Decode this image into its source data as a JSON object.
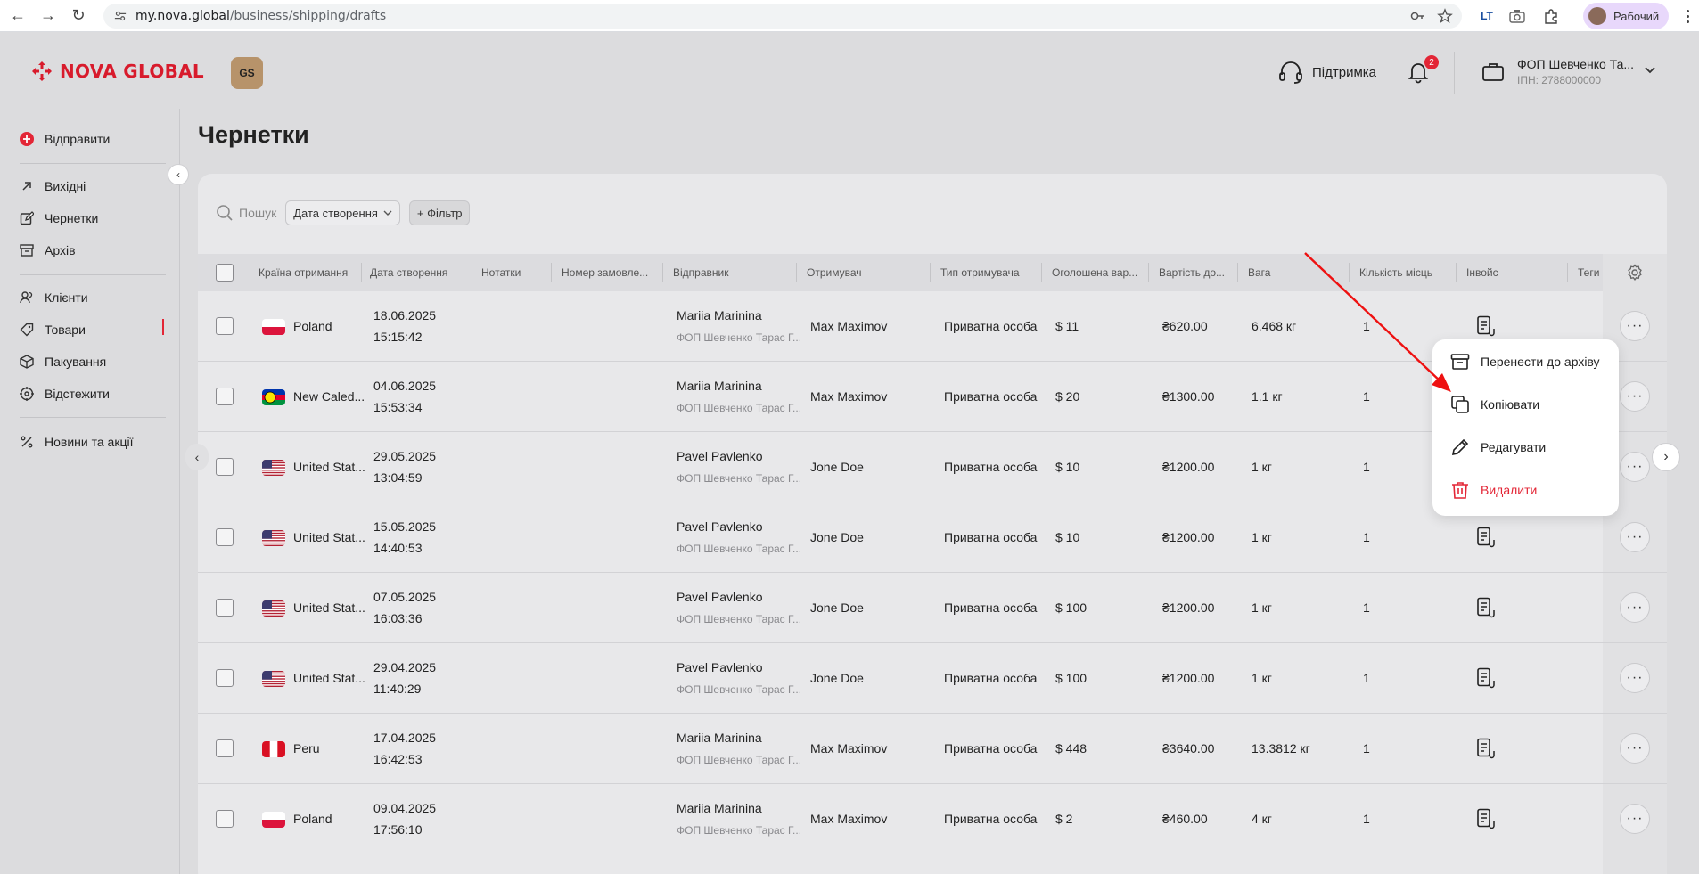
{
  "browser": {
    "url_host": "my.nova.global",
    "url_path": "/business/shipping/drafts",
    "profile_label": "Рабочий"
  },
  "header": {
    "logo_text": "NOVA GLOBAL",
    "workspace_badge": "GS",
    "support_label": "Підтримка",
    "notifications_count": "2",
    "company_name": "ФОП Шевченко Та...",
    "company_inn": "ІПН: 2788000000"
  },
  "sidebar": {
    "send_label": "Відправити",
    "items": [
      {
        "label": "Вихідні",
        "icon": "outgoing-arrow-icon"
      },
      {
        "label": "Чернетки",
        "icon": "edit-icon"
      },
      {
        "label": "Архів",
        "icon": "archive-icon"
      },
      {
        "label": "Клієнти",
        "icon": "users-icon"
      },
      {
        "label": "Товари",
        "icon": "tag-icon"
      },
      {
        "label": "Пакування",
        "icon": "box-icon"
      },
      {
        "label": "Відстежити",
        "icon": "track-icon"
      },
      {
        "label": "Новини та акції",
        "icon": "percent-icon"
      }
    ]
  },
  "page": {
    "title": "Чернетки",
    "search_placeholder": "Пошук",
    "sort_label": "Дата створення",
    "filter_label": "+ Фільтр"
  },
  "table": {
    "columns": [
      "Країна отримання",
      "Дата створення",
      "Нотатки",
      "Номер замовле...",
      "Відправник",
      "Отримувач",
      "Тип отримувача",
      "Оголошена вар...",
      "Вартість до...",
      "Вага",
      "Кількість місць",
      "Інвойс",
      "Теги"
    ],
    "rows": [
      {
        "country": "Poland",
        "flag": "pl",
        "date": "18.06.2025",
        "time": "15:15:42",
        "sender": "Mariia Marinina",
        "sender_company": "ФОП Шевченко Тарас Г...",
        "recipient": "Max Maximov",
        "recipient_type": "Приватна особа",
        "declared": "$ 11",
        "delivery": "₴620.00",
        "weight": "6.468 кг",
        "places": "1"
      },
      {
        "country": "New Caled...",
        "flag": "nc",
        "date": "04.06.2025",
        "time": "15:53:34",
        "sender": "Mariia Marinina",
        "sender_company": "ФОП Шевченко Тарас Г...",
        "recipient": "Max Maximov",
        "recipient_type": "Приватна особа",
        "declared": "$ 20",
        "delivery": "₴1300.00",
        "weight": "1.1 кг",
        "places": "1"
      },
      {
        "country": "United Stat...",
        "flag": "us",
        "date": "29.05.2025",
        "time": "13:04:59",
        "sender": "Pavel Pavlenko",
        "sender_company": "ФОП Шевченко Тарас Г...",
        "recipient": "Jone Doe",
        "recipient_type": "Приватна особа",
        "declared": "$ 10",
        "delivery": "₴1200.00",
        "weight": "1 кг",
        "places": "1"
      },
      {
        "country": "United Stat...",
        "flag": "us",
        "date": "15.05.2025",
        "time": "14:40:53",
        "sender": "Pavel Pavlenko",
        "sender_company": "ФОП Шевченко Тарас Г...",
        "recipient": "Jone Doe",
        "recipient_type": "Приватна особа",
        "declared": "$ 10",
        "delivery": "₴1200.00",
        "weight": "1 кг",
        "places": "1"
      },
      {
        "country": "United Stat...",
        "flag": "us",
        "date": "07.05.2025",
        "time": "16:03:36",
        "sender": "Pavel Pavlenko",
        "sender_company": "ФОП Шевченко Тарас Г...",
        "recipient": "Jone Doe",
        "recipient_type": "Приватна особа",
        "declared": "$ 100",
        "delivery": "₴1200.00",
        "weight": "1 кг",
        "places": "1"
      },
      {
        "country": "United Stat...",
        "flag": "us",
        "date": "29.04.2025",
        "time": "11:40:29",
        "sender": "Pavel Pavlenko",
        "sender_company": "ФОП Шевченко Тарас Г...",
        "recipient": "Jone Doe",
        "recipient_type": "Приватна особа",
        "declared": "$ 100",
        "delivery": "₴1200.00",
        "weight": "1 кг",
        "places": "1"
      },
      {
        "country": "Peru",
        "flag": "pe",
        "date": "17.04.2025",
        "time": "16:42:53",
        "sender": "Mariia Marinina",
        "sender_company": "ФОП Шевченко Тарас Г...",
        "recipient": "Max Maximov",
        "recipient_type": "Приватна особа",
        "declared": "$ 448",
        "delivery": "₴3640.00",
        "weight": "13.3812 кг",
        "places": "1"
      },
      {
        "country": "Poland",
        "flag": "pl",
        "date": "09.04.2025",
        "time": "17:56:10",
        "sender": "Mariia Marinina",
        "sender_company": "ФОП Шевченко Тарас Г...",
        "recipient": "Max Maximov",
        "recipient_type": "Приватна особа",
        "declared": "$ 2",
        "delivery": "₴460.00",
        "weight": "4 кг",
        "places": "1"
      }
    ]
  },
  "context_menu": {
    "items": [
      {
        "label": "Перенести до архіву",
        "icon": "archive-icon"
      },
      {
        "label": "Копіювати",
        "icon": "copy-icon"
      },
      {
        "label": "Редагувати",
        "icon": "pencil-icon"
      },
      {
        "label": "Видалити",
        "icon": "trash-icon"
      }
    ]
  },
  "colors": {
    "brand_red": "#e32636",
    "background": "#dcdcde",
    "panel": "#e8e8ea"
  }
}
